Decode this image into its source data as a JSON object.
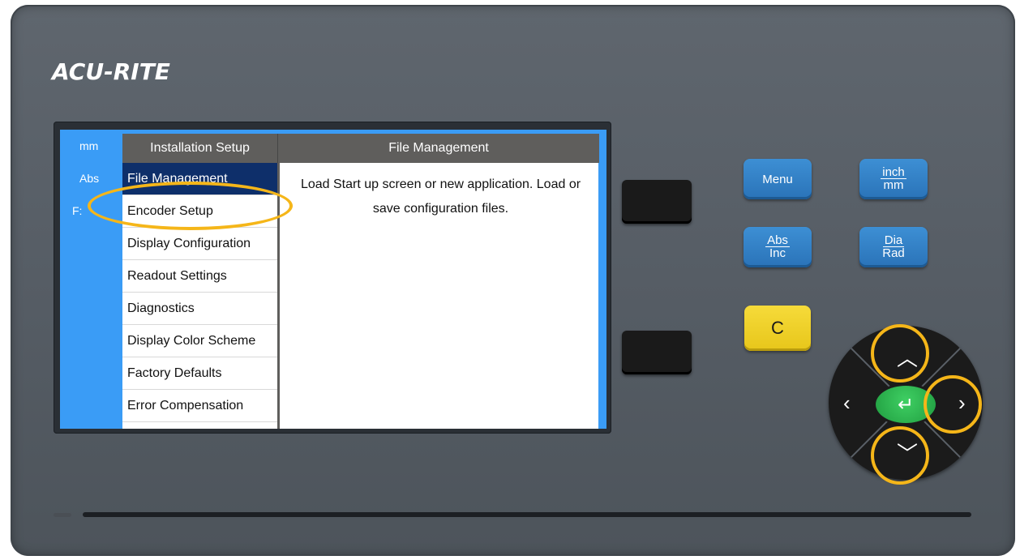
{
  "brand": {
    "logo": "ACU-RITE"
  },
  "screen": {
    "status": {
      "units": "mm",
      "mode": "Abs",
      "feed": "F:"
    },
    "menu_header": "Installation Setup",
    "content_header": "File Management",
    "menu_items": [
      {
        "label": "File Management",
        "selected": true
      },
      {
        "label": "Encoder Setup",
        "selected": false
      },
      {
        "label": "Display Configuration",
        "selected": false
      },
      {
        "label": "Readout Settings",
        "selected": false
      },
      {
        "label": "Diagnostics",
        "selected": false
      },
      {
        "label": "Display Color Scheme",
        "selected": false
      },
      {
        "label": "Factory Defaults",
        "selected": false
      },
      {
        "label": "Error Compensation",
        "selected": false
      }
    ],
    "content_text": "Load Start up screen or new application.  Load or save configuration files."
  },
  "keys": {
    "menu": "Menu",
    "inch_top": "inch",
    "inch_bottom": "mm",
    "abs_top": "Abs",
    "abs_bottom": "Inc",
    "dia_top": "Dia",
    "dia_bottom": "Rad",
    "clear": "C"
  },
  "colors": {
    "screen_background": "#3a9cf6",
    "selection": "#0e2f6a",
    "highlight": "#f5b619",
    "key_blue": "#2a73b8",
    "key_yellow": "#f0cf28",
    "enter_green": "#2fb552"
  },
  "icons": {
    "up": "chevron-up-icon",
    "down": "chevron-down-icon",
    "left": "chevron-left-icon",
    "right": "chevron-right-icon",
    "enter": "enter-icon"
  }
}
